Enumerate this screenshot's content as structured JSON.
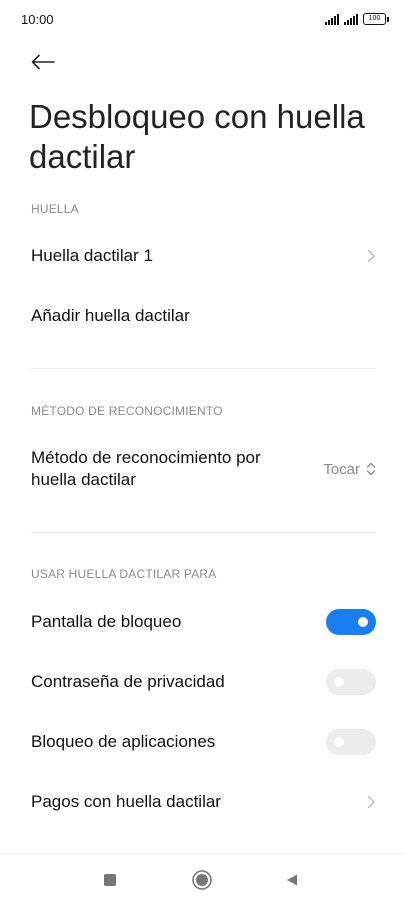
{
  "status_bar": {
    "time": "10:00",
    "battery": "100"
  },
  "header": {
    "back_icon": "arrow-left-icon",
    "title": "Desbloqueo con huella dactilar"
  },
  "sections": {
    "huella": {
      "header": "HUELLA",
      "items": [
        {
          "label": "Huella dactilar 1"
        },
        {
          "label": "Añadir huella dactilar"
        }
      ]
    },
    "metodo": {
      "header": "MÉTODO DE RECONOCIMIENTO",
      "item_label": "Método de reconocimiento por huella dactilar",
      "selected_value": "Tocar"
    },
    "usar": {
      "header": "USAR HUELLA DACTILAR PARA",
      "items": [
        {
          "label": "Pantalla de bloqueo",
          "enabled": true
        },
        {
          "label": "Contraseña de privacidad",
          "enabled": false
        },
        {
          "label": "Bloqueo de aplicaciones",
          "enabled": false
        },
        {
          "label": "Pagos con huella dactilar"
        }
      ]
    }
  },
  "colors": {
    "accent": "#1a7ef2",
    "toggle_off": "#ececec",
    "secondary_text": "#8a8a8a"
  },
  "nav_bar": {
    "icons": [
      "square-icon",
      "circle-home-icon",
      "triangle-back-icon"
    ]
  }
}
